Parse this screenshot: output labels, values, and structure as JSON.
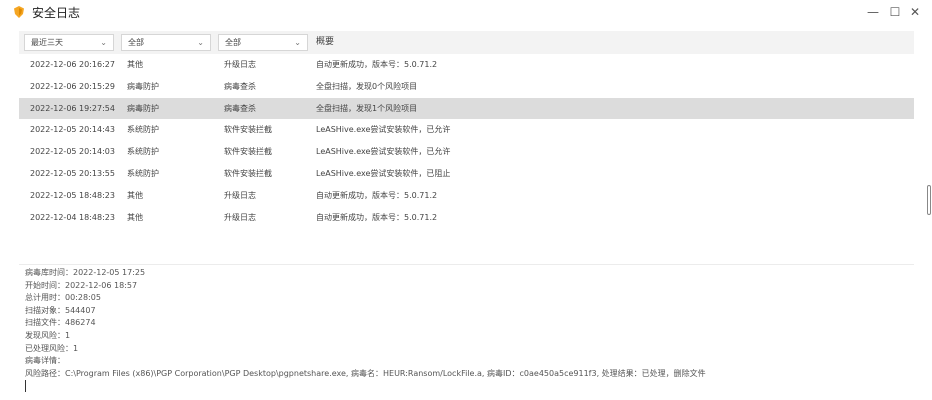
{
  "window": {
    "title": "安全日志",
    "minimize": "—",
    "maximize": "☐",
    "close": "✕"
  },
  "filters": {
    "time_range": "最近三天",
    "category": "全部",
    "type": "全部",
    "summary_header": "概要"
  },
  "rows": [
    {
      "time": "2022-12-06 20:16:27",
      "category": "其他",
      "type": "升级日志",
      "summary": "自动更新成功，版本号：5.0.71.2"
    },
    {
      "time": "2022-12-06 20:15:29",
      "category": "病毒防护",
      "type": "病毒查杀",
      "summary": "全盘扫描，发现0个风险项目"
    },
    {
      "time": "2022-12-06 19:27:54",
      "category": "病毒防护",
      "type": "病毒查杀",
      "summary": "全盘扫描，发现1个风险项目"
    },
    {
      "time": "2022-12-05 20:14:43",
      "category": "系统防护",
      "type": "软件安装拦截",
      "summary": "LeASHive.exe尝试安装软件，已允许"
    },
    {
      "time": "2022-12-05 20:14:03",
      "category": "系统防护",
      "type": "软件安装拦截",
      "summary": "LeASHive.exe尝试安装软件，已允许"
    },
    {
      "time": "2022-12-05 20:13:55",
      "category": "系统防护",
      "type": "软件安装拦截",
      "summary": "LeASHive.exe尝试安装软件，已阻止"
    },
    {
      "time": "2022-12-05 18:48:23",
      "category": "其他",
      "type": "升级日志",
      "summary": "自动更新成功，版本号：5.0.71.2"
    },
    {
      "time": "2022-12-04 18:48:23",
      "category": "其他",
      "type": "升级日志",
      "summary": "自动更新成功，版本号：5.0.71.2"
    }
  ],
  "selected_row_index": 2,
  "details": [
    "病毒库时间：2022-12-05 17:25",
    "开始时间：2022-12-06 18:57",
    "总计用时：00:28:05",
    "扫描对象：544407",
    "扫描文件：486274",
    "发现风险：1",
    "已处理风险：1",
    "病毒详情：",
    "风险路径：C:\\Program Files (x86)\\PGP Corporation\\PGP Desktop\\pgpnetshare.exe, 病毒名：HEUR:Ransom/LockFile.a, 病毒ID：c0ae450a5ce911f3, 处理结果：已处理，删除文件"
  ],
  "colors": {
    "logo_primary": "#f5a623",
    "selected_row": "#dcdcdc",
    "filter_bar": "#f3f3f3"
  }
}
